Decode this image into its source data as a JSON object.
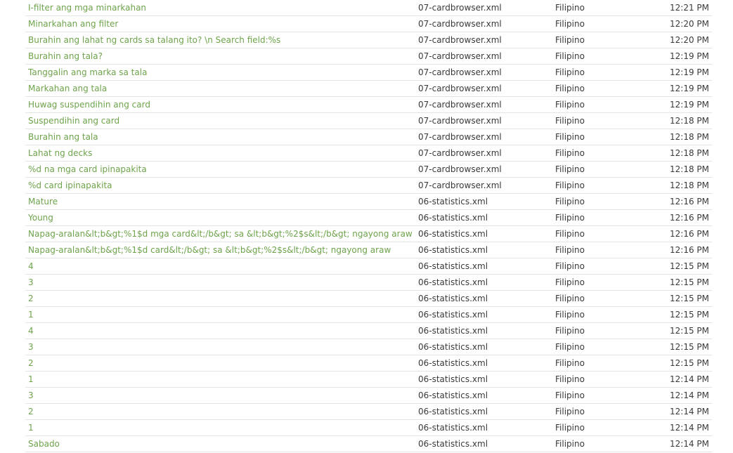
{
  "rows": [
    {
      "string": "I-filter ang mga minarkahan",
      "file": "07-cardbrowser.xml",
      "language": "Filipino",
      "time": "12:21 PM"
    },
    {
      "string": "Minarkahan ang filter",
      "file": "07-cardbrowser.xml",
      "language": "Filipino",
      "time": "12:20 PM"
    },
    {
      "string": "Burahin ang lahat ng cards sa talang ito? \\n Search field:%s",
      "file": "07-cardbrowser.xml",
      "language": "Filipino",
      "time": "12:20 PM"
    },
    {
      "string": "Burahin ang tala?",
      "file": "07-cardbrowser.xml",
      "language": "Filipino",
      "time": "12:19 PM"
    },
    {
      "string": "Tanggalin ang marka sa tala",
      "file": "07-cardbrowser.xml",
      "language": "Filipino",
      "time": "12:19 PM"
    },
    {
      "string": "Markahan ang tala",
      "file": "07-cardbrowser.xml",
      "language": "Filipino",
      "time": "12:19 PM"
    },
    {
      "string": "Huwag suspendihin ang card",
      "file": "07-cardbrowser.xml",
      "language": "Filipino",
      "time": "12:19 PM"
    },
    {
      "string": "Suspendihin ang card",
      "file": "07-cardbrowser.xml",
      "language": "Filipino",
      "time": "12:18 PM"
    },
    {
      "string": "Burahin ang tala",
      "file": "07-cardbrowser.xml",
      "language": "Filipino",
      "time": "12:18 PM"
    },
    {
      "string": "Lahat ng decks",
      "file": "07-cardbrowser.xml",
      "language": "Filipino",
      "time": "12:18 PM"
    },
    {
      "string": "%d na mga card ipinapakita",
      "file": "07-cardbrowser.xml",
      "language": "Filipino",
      "time": "12:18 PM"
    },
    {
      "string": "%d card ipinapakita",
      "file": "07-cardbrowser.xml",
      "language": "Filipino",
      "time": "12:18 PM"
    },
    {
      "string": "Mature",
      "file": "06-statistics.xml",
      "language": "Filipino",
      "time": "12:16 PM"
    },
    {
      "string": "Young",
      "file": "06-statistics.xml",
      "language": "Filipino",
      "time": "12:16 PM"
    },
    {
      "string": "Napag-aralan&lt;b&gt;%1$d mga card&lt;/b&gt; sa &lt;b&gt;%2$s&lt;/b&gt; ngayong araw",
      "file": "06-statistics.xml",
      "language": "Filipino",
      "time": "12:16 PM"
    },
    {
      "string": "Napag-aralan&lt;b&gt;%1$d card&lt;/b&gt; sa &lt;b&gt;%2$s&lt;/b&gt; ngayong araw",
      "file": "06-statistics.xml",
      "language": "Filipino",
      "time": "12:16 PM"
    },
    {
      "string": "4",
      "file": "06-statistics.xml",
      "language": "Filipino",
      "time": "12:15 PM"
    },
    {
      "string": "3",
      "file": "06-statistics.xml",
      "language": "Filipino",
      "time": "12:15 PM"
    },
    {
      "string": "2",
      "file": "06-statistics.xml",
      "language": "Filipino",
      "time": "12:15 PM"
    },
    {
      "string": "1",
      "file": "06-statistics.xml",
      "language": "Filipino",
      "time": "12:15 PM"
    },
    {
      "string": "4",
      "file": "06-statistics.xml",
      "language": "Filipino",
      "time": "12:15 PM"
    },
    {
      "string": "3",
      "file": "06-statistics.xml",
      "language": "Filipino",
      "time": "12:15 PM"
    },
    {
      "string": "2",
      "file": "06-statistics.xml",
      "language": "Filipino",
      "time": "12:15 PM"
    },
    {
      "string": "1",
      "file": "06-statistics.xml",
      "language": "Filipino",
      "time": "12:14 PM"
    },
    {
      "string": "3",
      "file": "06-statistics.xml",
      "language": "Filipino",
      "time": "12:14 PM"
    },
    {
      "string": "2",
      "file": "06-statistics.xml",
      "language": "Filipino",
      "time": "12:14 PM"
    },
    {
      "string": "1",
      "file": "06-statistics.xml",
      "language": "Filipino",
      "time": "12:14 PM"
    },
    {
      "string": "Sabado",
      "file": "06-statistics.xml",
      "language": "Filipino",
      "time": "12:14 PM"
    }
  ],
  "colors": {
    "link": "#6ea34b",
    "text": "#3a3a3a",
    "divider": "#e4e4e4"
  }
}
